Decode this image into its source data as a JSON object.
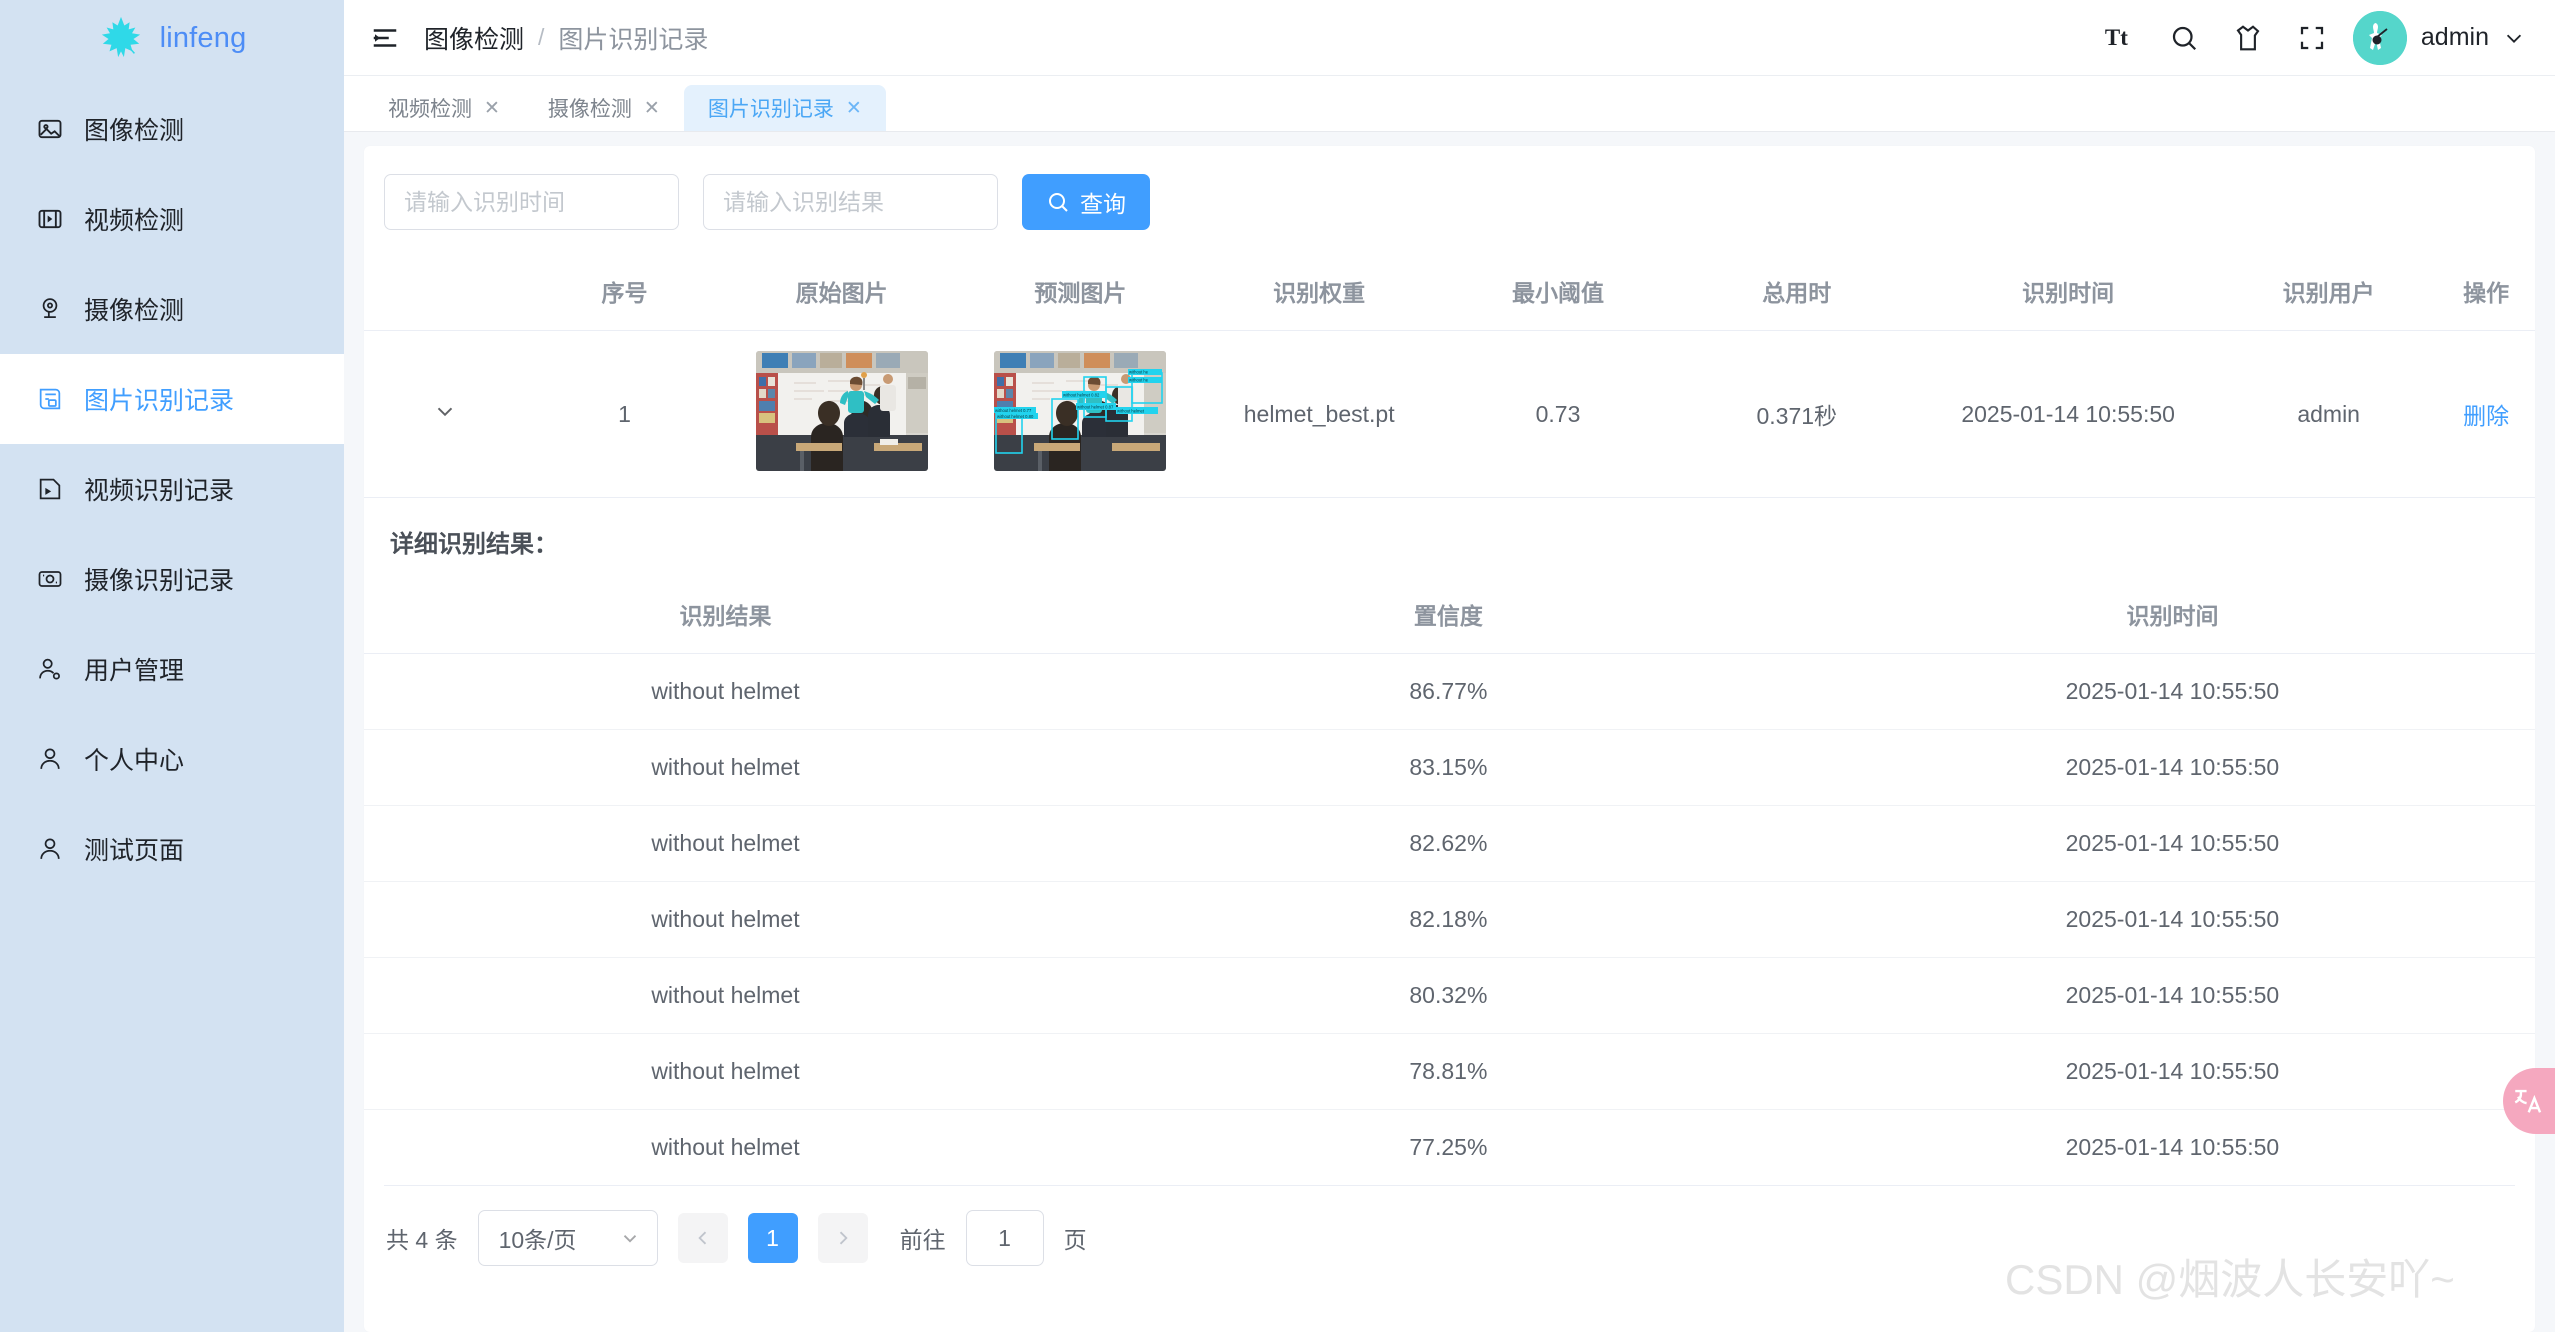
{
  "brand": {
    "name": "linfeng",
    "logo_icon": "maple-leaf-icon",
    "logo_color": "#2fd9e8",
    "text_color": "#4d8df6"
  },
  "sidebar": {
    "items": [
      {
        "label": "图像检测",
        "icon": "image-icon",
        "active": false
      },
      {
        "label": "视频检测",
        "icon": "video-icon",
        "active": false
      },
      {
        "label": "摄像检测",
        "icon": "camera-icon",
        "active": false
      },
      {
        "label": "图片识别记录",
        "icon": "image-record-icon",
        "active": true
      },
      {
        "label": "视频识别记录",
        "icon": "video-record-icon",
        "active": false
      },
      {
        "label": "摄像识别记录",
        "icon": "camera-record-icon",
        "active": false
      },
      {
        "label": "用户管理",
        "icon": "user-gear-icon",
        "active": false
      },
      {
        "label": "个人中心",
        "icon": "user-icon",
        "active": false
      },
      {
        "label": "测试页面",
        "icon": "user-icon",
        "active": false
      }
    ]
  },
  "topbar": {
    "menu_icon": "hamburger-collapse-icon",
    "breadcrumb": {
      "parent": "图像检测",
      "separator": "/",
      "current": "图片识别记录"
    },
    "icons": [
      {
        "name": "font-size-icon",
        "glyph": "Tt"
      },
      {
        "name": "search-icon",
        "glyph": ""
      },
      {
        "name": "theme-shirt-icon",
        "glyph": ""
      },
      {
        "name": "fullscreen-icon",
        "glyph": ""
      }
    ],
    "user": {
      "name": "admin",
      "avatar_color": "#55d6cb",
      "caret": "chevron-down-icon"
    }
  },
  "tabs": [
    {
      "label": "视频检测",
      "active": false,
      "closable": true
    },
    {
      "label": "摄像检测",
      "active": false,
      "closable": true
    },
    {
      "label": "图片识别记录",
      "active": true,
      "closable": true
    }
  ],
  "filters": {
    "time_placeholder": "请输入识别时间",
    "time_value": "",
    "result_placeholder": "请输入识别结果",
    "result_value": "",
    "search_button": "查询",
    "search_icon": "search-icon",
    "accent": "#409eff"
  },
  "main_table": {
    "headers": [
      "序号",
      "原始图片",
      "预测图片",
      "识别权重",
      "最小阈值",
      "总用时",
      "识别时间",
      "识别用户",
      "操作"
    ],
    "rows": [
      {
        "expand_icon": "chevron-down-icon",
        "index": "1",
        "original_image": "classroom-original-thumbnail",
        "predicted_image": "classroom-predicted-thumbnail",
        "weight": "helmet_best.pt",
        "threshold": "0.73",
        "duration": "0.371秒",
        "time": "2025-01-14 10:55:50",
        "user": "admin",
        "action": "删除"
      }
    ]
  },
  "detail": {
    "title": "详细识别结果：",
    "headers": [
      "识别结果",
      "置信度",
      "识别时间"
    ],
    "rows": [
      {
        "result": "without helmet",
        "confidence": "86.77%",
        "time": "2025-01-14 10:55:50"
      },
      {
        "result": "without helmet",
        "confidence": "83.15%",
        "time": "2025-01-14 10:55:50"
      },
      {
        "result": "without helmet",
        "confidence": "82.62%",
        "time": "2025-01-14 10:55:50"
      },
      {
        "result": "without helmet",
        "confidence": "82.18%",
        "time": "2025-01-14 10:55:50"
      },
      {
        "result": "without helmet",
        "confidence": "80.32%",
        "time": "2025-01-14 10:55:50"
      },
      {
        "result": "without helmet",
        "confidence": "78.81%",
        "time": "2025-01-14 10:55:50"
      },
      {
        "result": "without helmet",
        "confidence": "77.25%",
        "time": "2025-01-14 10:55:50"
      }
    ]
  },
  "pagination": {
    "total_text": "共 4 条",
    "page_size": "10条/页",
    "prev_icon": "chevron-left-icon",
    "next_icon": "chevron-right-icon",
    "current_page": "1",
    "jump_label": "前往",
    "jump_value": "1",
    "jump_unit": "页"
  },
  "fab": {
    "icon": "translate-icon",
    "color": "#f5a8bf"
  },
  "watermark": {
    "text": "CSDN @烟波人长安吖~"
  },
  "detection_labels": [
    "without helmet 0.82",
    "without helmet 0.87",
    "without helmet 0.80",
    "without helmet 0.77"
  ]
}
